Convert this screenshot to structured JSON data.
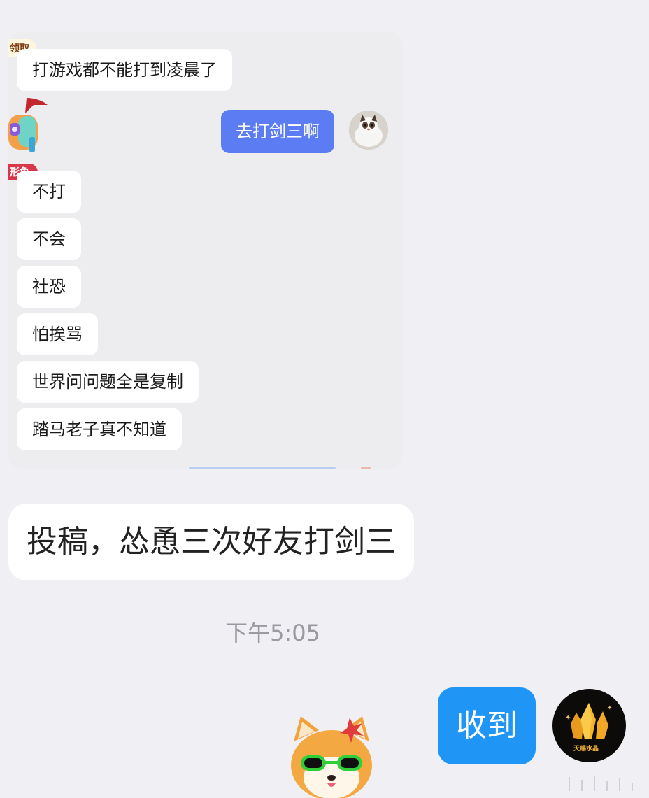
{
  "chat_card": {
    "top_tag": "领取",
    "side_tag": "形象",
    "messages_in_top": "打游戏都不能打到凌晨了",
    "message_out": "去打剑三啊",
    "replies": [
      "不打",
      "不会",
      "社恐",
      "怕挨骂",
      "世界问问题全是复制",
      "踏马老子真不知道"
    ]
  },
  "submission_bubble": "投稿，怂恿三次好友打剑三",
  "timestamp": "下午5:05",
  "reply_bubble": "收到",
  "avatar_crystal_caption": "天赐水晶",
  "colors": {
    "outgoing_bubble": "#5b7cf2",
    "reply_bubble": "#1f96f5",
    "background": "#efeff4"
  }
}
